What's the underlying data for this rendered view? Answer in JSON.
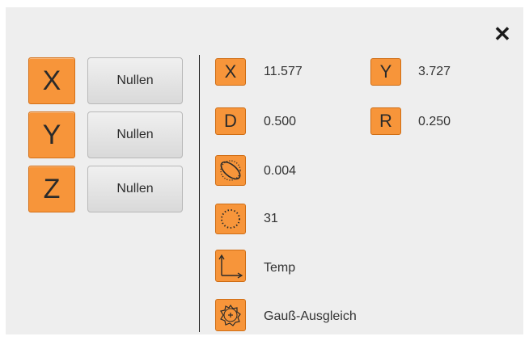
{
  "close": {
    "icon": "close-icon",
    "glyph": "✕"
  },
  "axes": [
    {
      "label": "X",
      "null_label": "Nullen"
    },
    {
      "label": "Y",
      "null_label": "Nullen"
    },
    {
      "label": "Z",
      "null_label": "Nullen"
    }
  ],
  "readouts": {
    "x": {
      "label": "X",
      "value": "11.577"
    },
    "y": {
      "label": "Y",
      "value": "3.727"
    },
    "d": {
      "label": "D",
      "value": "0.500"
    },
    "r": {
      "label": "R",
      "value": "0.250"
    },
    "form": {
      "icon": "ellipse-form-icon",
      "value": "0.004"
    },
    "points": {
      "icon": "circle-points-icon",
      "value": "31"
    },
    "temp": {
      "icon": "axis-corner-icon",
      "value": "Temp"
    },
    "gauss": {
      "icon": "gauss-fit-icon",
      "value": "Gauß-Ausgleich"
    }
  },
  "colors": {
    "accent": "#f7953a",
    "panel": "#eeeeee"
  }
}
